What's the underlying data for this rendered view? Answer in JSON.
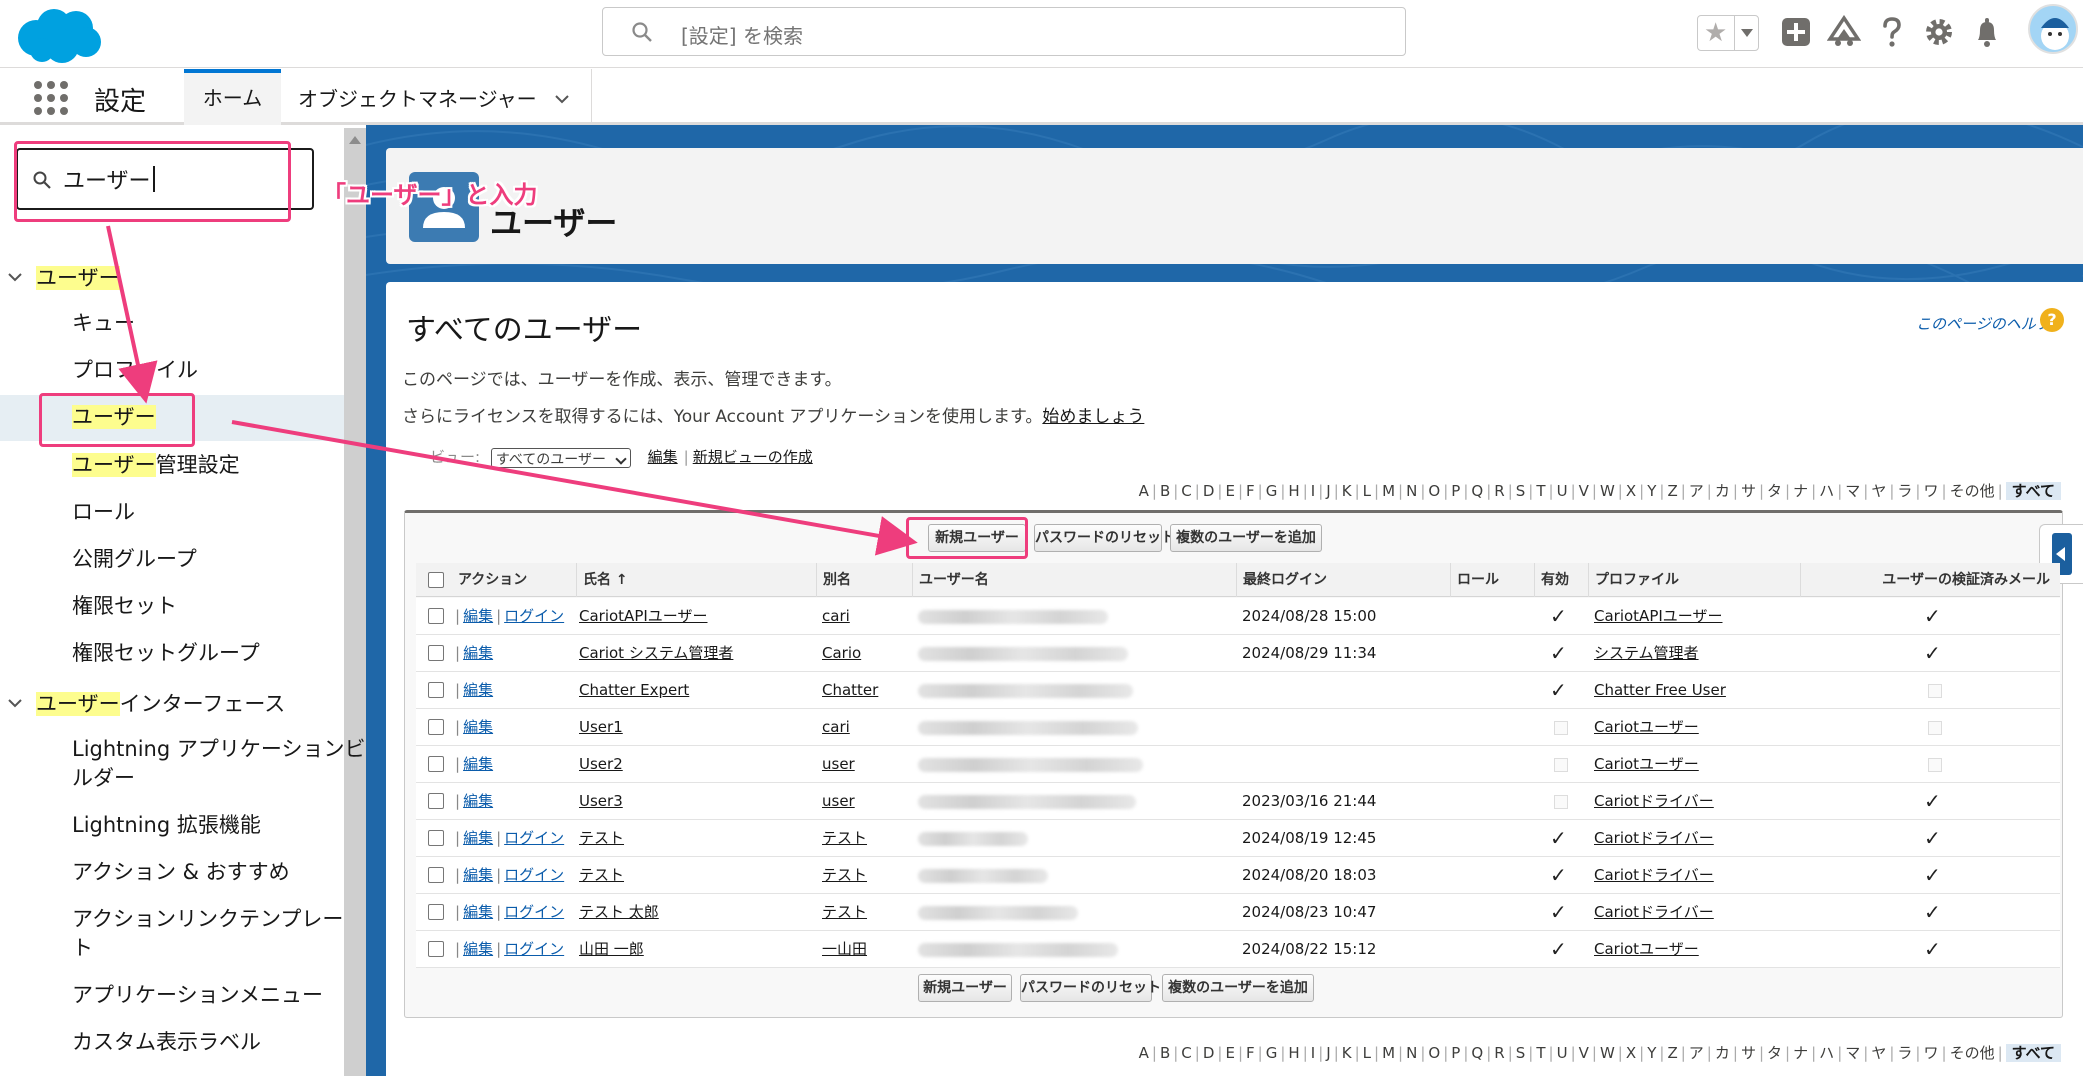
{
  "header": {
    "search_placeholder": "[設定] を検索",
    "icons": [
      "favorites-star-icon",
      "add-icon",
      "trailhead-icon",
      "help-icon",
      "settings-gear-icon",
      "notification-bell-icon",
      "avatar"
    ]
  },
  "nav": {
    "app_name": "設定",
    "tabs": [
      {
        "label": "ホーム",
        "active": true
      },
      {
        "label": "オブジェクトマネージャー",
        "active": false
      }
    ]
  },
  "sidebar": {
    "quickfind_value": "ユーザー",
    "categories": [
      {
        "label_hl": "ユーザー",
        "label_rest": ""
      },
      {
        "label_hl": "ユーザー",
        "label_rest": "インターフェース"
      }
    ],
    "items": [
      {
        "hl": "",
        "rest": "キュー"
      },
      {
        "hl": "",
        "rest": "プロファイル"
      },
      {
        "hl": "ユーザー",
        "rest": ""
      },
      {
        "hl": "ユーザー",
        "rest": "管理設定"
      },
      {
        "hl": "",
        "rest": "ロール"
      },
      {
        "hl": "",
        "rest": "公開グループ"
      },
      {
        "hl": "",
        "rest": "権限セット"
      },
      {
        "hl": "",
        "rest": "権限セットグループ"
      }
    ],
    "items2": [
      {
        "line1": "Lightning アプリケーションビ",
        "line2": "ルダー"
      },
      {
        "line1": "Lightning 拡張機能",
        "line2": ""
      },
      {
        "line1": "アクション & おすすめ",
        "line2": ""
      },
      {
        "line1": "アクションリンクテンプレー",
        "line2": "ト"
      },
      {
        "line1": "アプリケーションメニュー",
        "line2": ""
      },
      {
        "line1": "カスタム表示ラベル",
        "line2": ""
      }
    ]
  },
  "page_header": {
    "title": "ユーザー"
  },
  "content": {
    "title": "すべてのユーザー",
    "help_link": "このページのヘルプ",
    "help_icon": "?",
    "description": "このページでは、ユーザーを作成、表示、管理できます。",
    "license_text": "さらにライセンスを取得するには、Your Account アプリケーションを使用します。",
    "license_link": "始めましょう",
    "view_label": "ビュー:",
    "view_selected": "すべてのユーザー",
    "view_edit": "編集",
    "view_new": "新規ビューの作成",
    "view_sep": "|"
  },
  "alphabet": [
    "A",
    "B",
    "C",
    "D",
    "E",
    "F",
    "G",
    "H",
    "I",
    "J",
    "K",
    "L",
    "M",
    "N",
    "O",
    "P",
    "Q",
    "R",
    "S",
    "T",
    "U",
    "V",
    "W",
    "X",
    "Y",
    "Z",
    "ア",
    "カ",
    "サ",
    "タ",
    "ナ",
    "ハ",
    "マ",
    "ヤ",
    "ラ",
    "ワ",
    "その他",
    "すべて"
  ],
  "buttons": {
    "new_user": "新規ユーザー",
    "reset_password": "パスワードのリセット",
    "add_multiple": "複数のユーザーを追加"
  },
  "table": {
    "columns": [
      "アクション",
      "氏名 ↑",
      "別名",
      "ユーザー名",
      "最終ログイン",
      "ロール",
      "有効",
      "プロファイル",
      "ユーザーの検証済みメール"
    ],
    "rows": [
      {
        "edit": "編集",
        "login": "ログイン",
        "name": "CariotAPIユーザー",
        "alias": "cari",
        "last_login": "2024/08/28 15:00",
        "role": "",
        "active": true,
        "profile": "CariotAPIユーザー",
        "verified": true
      },
      {
        "edit": "編集",
        "login": "",
        "name": "Cariot システム管理者",
        "alias": "Cario",
        "last_login": "2024/08/29 11:34",
        "role": "",
        "active": true,
        "profile": "システム管理者",
        "verified": true
      },
      {
        "edit": "編集",
        "login": "",
        "name": "Chatter Expert",
        "alias": "Chatter",
        "last_login": "",
        "role": "",
        "active": true,
        "profile": "Chatter Free User",
        "verified": false
      },
      {
        "edit": "編集",
        "login": "",
        "name": "User1",
        "alias": "cari",
        "last_login": "",
        "role": "",
        "active": false,
        "profile": "Cariotユーザー",
        "verified": false
      },
      {
        "edit": "編集",
        "login": "",
        "name": "User2",
        "alias": "user",
        "last_login": "",
        "role": "",
        "active": false,
        "profile": "Cariotユーザー",
        "verified": false
      },
      {
        "edit": "編集",
        "login": "",
        "name": "User3",
        "alias": "user",
        "last_login": "2023/03/16 21:44",
        "role": "",
        "active": false,
        "profile": "Cariotドライバー",
        "verified": true
      },
      {
        "edit": "編集",
        "login": "ログイン",
        "name": "テスト",
        "alias": "テスト",
        "last_login": "2024/08/19 12:45",
        "role": "",
        "active": true,
        "profile": "Cariotドライバー",
        "verified": true
      },
      {
        "edit": "編集",
        "login": "ログイン",
        "name": "テスト",
        "alias": "テスト",
        "last_login": "2024/08/20 18:03",
        "role": "",
        "active": true,
        "profile": "Cariotドライバー",
        "verified": true
      },
      {
        "edit": "編集",
        "login": "ログイン",
        "name": "テスト 太郎",
        "alias": "テスト",
        "last_login": "2024/08/23 10:47",
        "role": "",
        "active": true,
        "profile": "Cariotドライバー",
        "verified": true
      },
      {
        "edit": "編集",
        "login": "ログイン",
        "name": "山田 一郎",
        "alias": "一山田",
        "last_login": "2024/08/22 15:12",
        "role": "",
        "active": true,
        "profile": "Cariotユーザー",
        "verified": true
      }
    ]
  },
  "annotation": {
    "text": "「ユーザー」と入力",
    "color": "#ee3d7d"
  },
  "colors": {
    "brand": "#0176d3",
    "header_band": "#1f67a8",
    "annotation": "#ee3d7d",
    "highlight": "#fdfd8e"
  }
}
